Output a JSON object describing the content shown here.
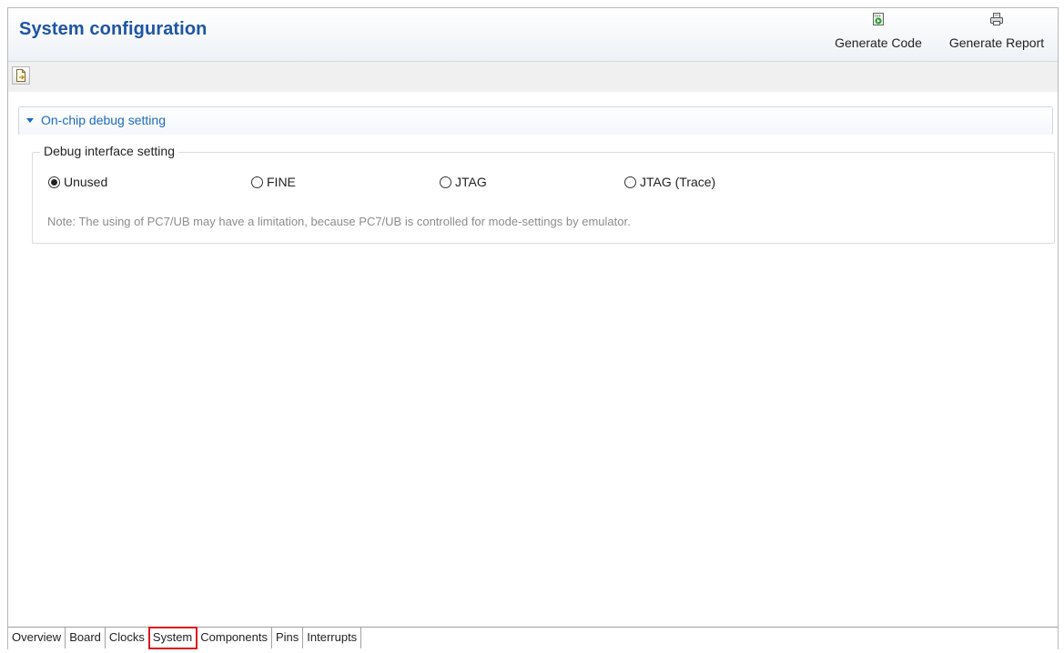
{
  "header": {
    "title": "System configuration",
    "generate_code_label": "Generate Code",
    "generate_report_label": "Generate Report",
    "generate_code_icon": "generate-code-icon",
    "generate_report_icon": "printer-icon"
  },
  "toolbar": {
    "export_icon": "export-document-icon"
  },
  "section": {
    "title": "On-chip debug setting",
    "expanded": true,
    "accent_color": "#1f69c1"
  },
  "debug_group": {
    "legend": "Debug interface setting",
    "options": [
      {
        "label": "Unused",
        "checked": true
      },
      {
        "label": "FINE",
        "checked": false
      },
      {
        "label": "JTAG",
        "checked": false
      },
      {
        "label": "JTAG (Trace)",
        "checked": false
      }
    ],
    "note": "Note: The using of PC7/UB may have a limitation, because PC7/UB is controlled for mode-settings by emulator."
  },
  "tabs": [
    {
      "label": "Overview",
      "active": false
    },
    {
      "label": "Board",
      "active": false
    },
    {
      "label": "Clocks",
      "active": false
    },
    {
      "label": "System",
      "active": true
    },
    {
      "label": "Components",
      "active": false
    },
    {
      "label": "Pins",
      "active": false
    },
    {
      "label": "Interrupts",
      "active": false
    }
  ],
  "colors": {
    "title": "#1f55a3",
    "active_tab_highlight": "#e0141e"
  }
}
